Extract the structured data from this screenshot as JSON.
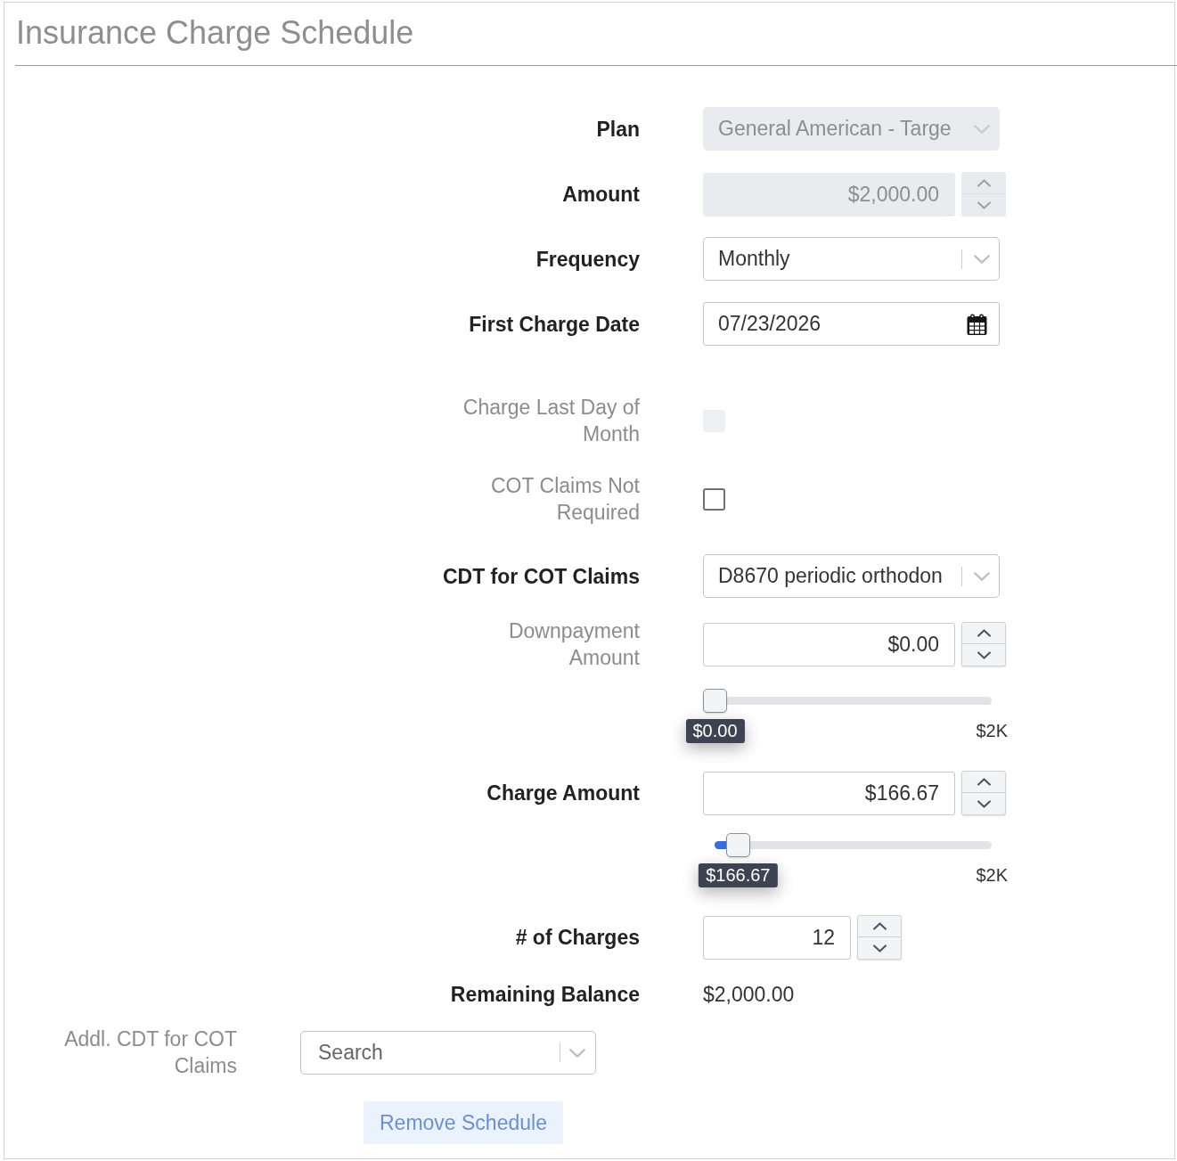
{
  "title": "Insurance Charge Schedule",
  "fields": [
    {
      "kind": "dropdown",
      "label": "Plan",
      "required": true,
      "value": "General American - Targe",
      "disabled": true
    },
    {
      "kind": "money",
      "label": "Amount",
      "required": true,
      "value": "$2,000.00",
      "disabled": true
    },
    {
      "kind": "dropdown",
      "label": "Frequency",
      "required": true,
      "value": "Monthly",
      "disabled": false
    },
    {
      "kind": "date",
      "label": "First Charge Date",
      "required": true,
      "value": "07/23/2026"
    },
    {
      "kind": "checkbox",
      "label": "Charge Last Day of Month",
      "required": false,
      "checked": false,
      "disabled": true
    },
    {
      "kind": "checkbox",
      "label": "COT Claims Not Required",
      "required": false,
      "checked": false,
      "disabled": false
    },
    {
      "kind": "dropdown",
      "label": "CDT for COT Claims",
      "required": true,
      "value": "D8670 periodic orthodon",
      "disabled": false
    },
    {
      "kind": "money",
      "label": "Downpayment Amount",
      "required": false,
      "value": "$0.00",
      "disabled": false,
      "slider": {
        "level": 0,
        "tooltip": "$0.00",
        "max_label": "$2K"
      }
    },
    {
      "kind": "money",
      "label": "Charge Amount",
      "required": true,
      "value": "$166.67",
      "disabled": false,
      "slider": {
        "level": 0.083,
        "tooltip": "$166.67",
        "max_label": "$2K"
      }
    },
    {
      "kind": "integer",
      "label": "# of Charges",
      "required": true,
      "value": "12",
      "disabled": false
    },
    {
      "kind": "text",
      "label": "Remaining Balance",
      "required": true,
      "value": "$2,000.00"
    }
  ],
  "additional_field": {
    "label": "Addl. CDT for COT Claims",
    "required": false,
    "placeholder": "Search"
  },
  "remove_button": {
    "label": "Remove Schedule"
  }
}
